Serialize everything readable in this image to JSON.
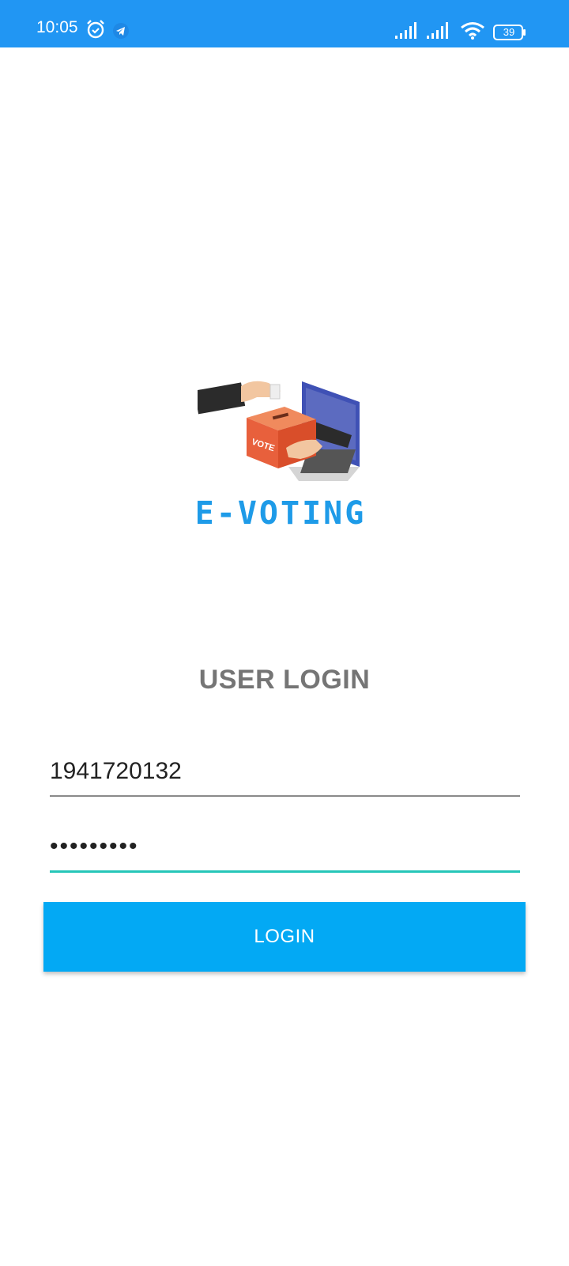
{
  "status_bar": {
    "time": "10:05",
    "battery_level": "39",
    "icons": [
      "alarm-icon",
      "telegram-icon",
      "signal-icon",
      "signal-icon",
      "wifi-icon",
      "battery-icon"
    ]
  },
  "logo": {
    "text": "E-VOTING",
    "box_label": "VOTE"
  },
  "login": {
    "title": "USER LOGIN",
    "username_value": "1941720132",
    "password_value": "•••••••••",
    "button_label": "LOGIN"
  },
  "colors": {
    "status_bar": "#2196F3",
    "button": "#03A9F4",
    "accent_underline": "#26C6B8",
    "title_text": "#757575"
  }
}
